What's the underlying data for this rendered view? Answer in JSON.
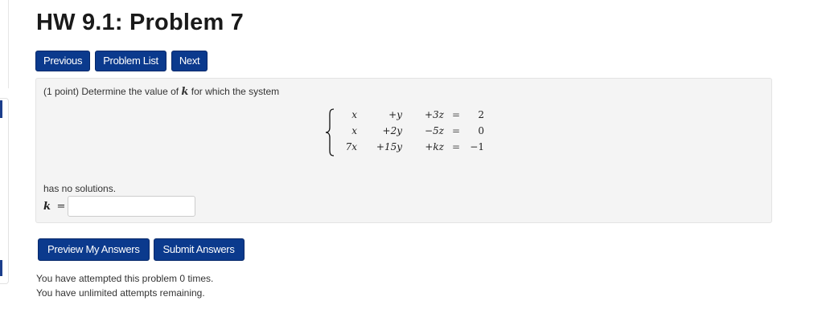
{
  "page": {
    "title": "HW 9.1: Problem 7"
  },
  "nav": {
    "previous_label": "Previous",
    "problem_list_label": "Problem List",
    "next_label": "Next"
  },
  "problem": {
    "intro_before": "(1 point) Determine the value of ",
    "variable": "k",
    "intro_after": " for which the system",
    "system": [
      {
        "x": "x",
        "y": "+y",
        "z": "+3z",
        "eq": "=",
        "rhs": "2"
      },
      {
        "x": "x",
        "y": "+2y",
        "z": "−5z",
        "eq": "=",
        "rhs": "0"
      },
      {
        "x": "7x",
        "y": "+15y",
        "z": "+kz",
        "eq": "=",
        "rhs": "−1"
      }
    ],
    "conclusion": "has no solutions.",
    "answer_label": "k",
    "answer_eq": "=",
    "answer_value": ""
  },
  "actions": {
    "preview_label": "Preview My Answers",
    "submit_label": "Submit Answers"
  },
  "status": {
    "attempts_text": "You have attempted this problem 0 times.",
    "remaining_text": "You have unlimited attempts remaining."
  },
  "colors": {
    "button_bg": "#0b3a8d",
    "panel_bg": "#f4f4f4"
  }
}
